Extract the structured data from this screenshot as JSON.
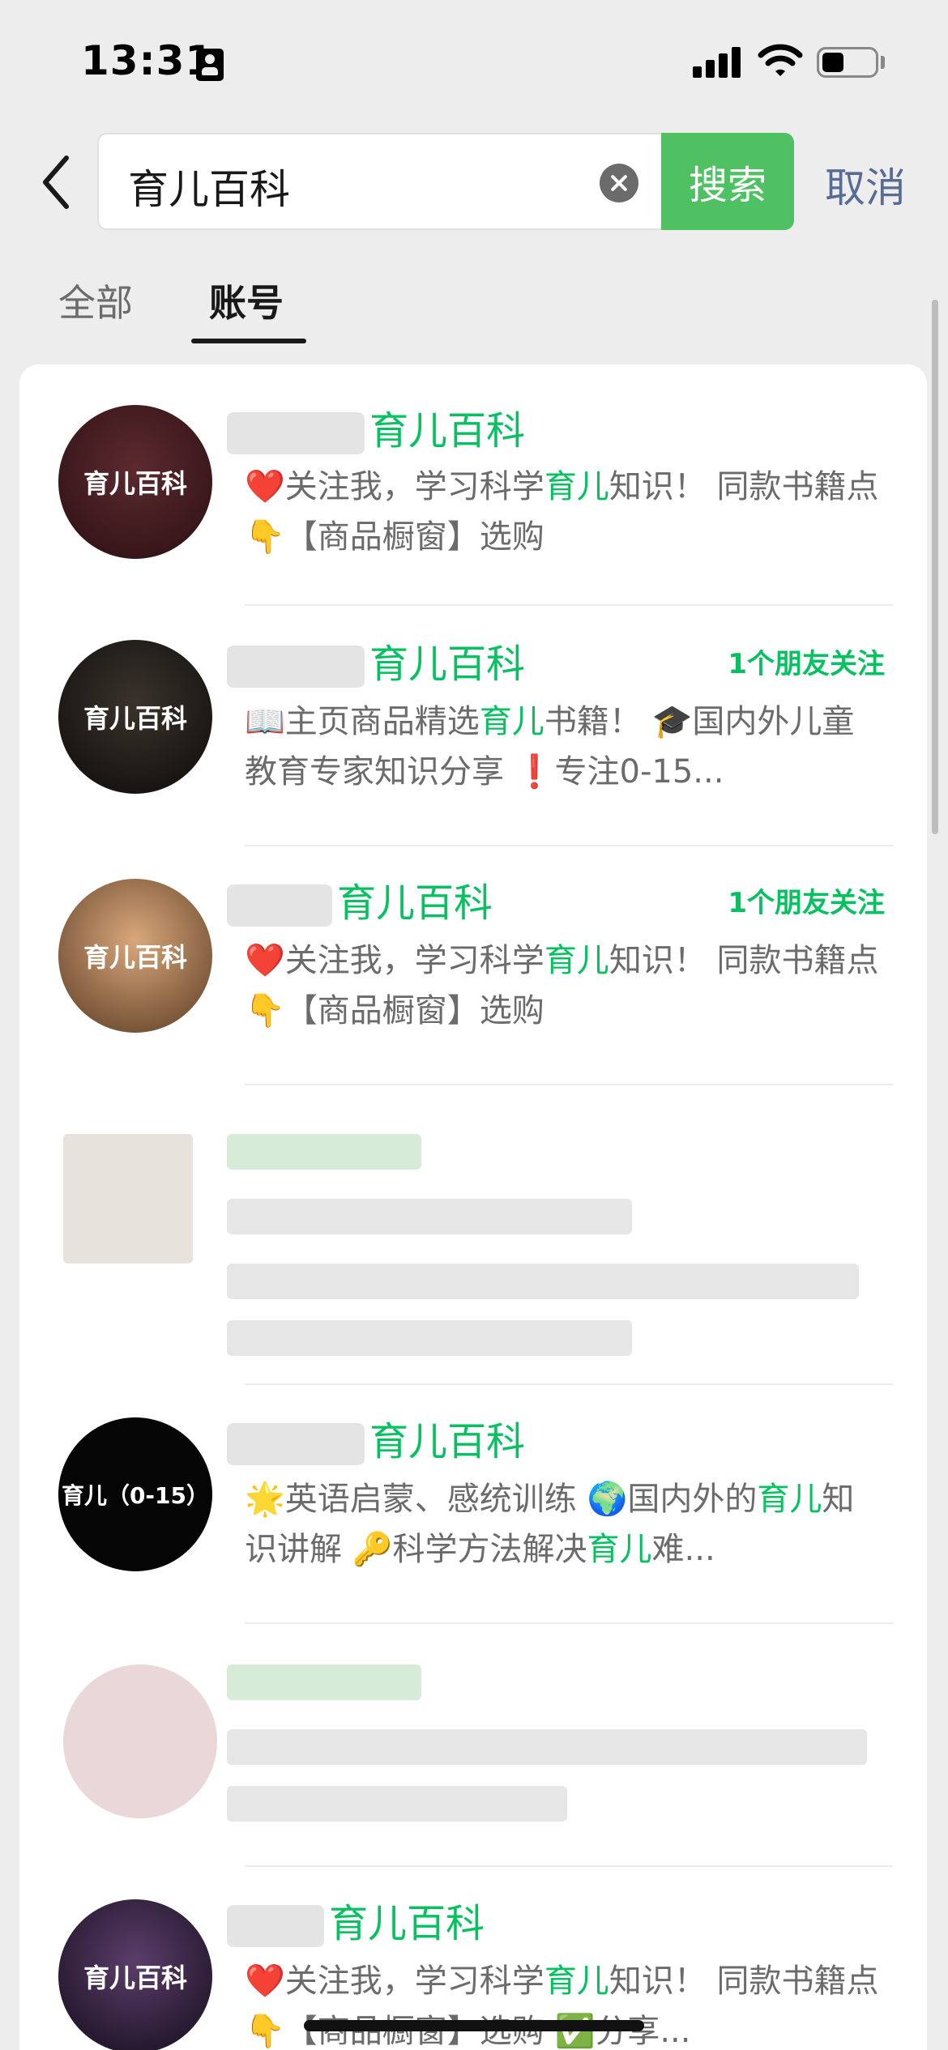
{
  "status_bar": {
    "time": "13:31",
    "battery_level": 0.4
  },
  "search": {
    "query": "育儿百科",
    "search_button": "搜索",
    "cancel_button": "取消"
  },
  "tabs": [
    {
      "label": "全部"
    },
    {
      "label": "账号"
    }
  ],
  "results": [
    {
      "avatar_text": "育儿百科",
      "avatar_color": "#3a1a1e",
      "name": "育儿百科",
      "friends": "",
      "desc_parts": [
        "❤️关注我，学习科学",
        "育儿",
        "知识！ 同款书籍点 👇【商品橱窗】选购"
      ]
    },
    {
      "avatar_text": "育儿百科",
      "avatar_color": "#1e1a18",
      "name": "育儿百科",
      "friends": "1个朋友关注",
      "desc_parts": [
        "📖主页商品精选",
        "育儿",
        "书籍！ 🎓国内外儿童教育专家知识分享 ❗专注0-15..."
      ]
    },
    {
      "avatar_text": "育儿百科",
      "avatar_color": "#b58b63",
      "name": "育儿百科",
      "friends": "1个朋友关注",
      "desc_parts": [
        "❤️关注我，学习科学",
        "育儿",
        "知识！ 同款书籍点 👇【商品橱窗】选购"
      ]
    },
    {
      "avatar_text": "育儿（0-15）",
      "avatar_color": "#050505",
      "name": "育儿百科",
      "friends": "",
      "desc_parts": [
        "🌟英语启蒙、感统训练 🌍国内外的",
        "育儿",
        "知识讲解 🔑科学方法解决",
        "育儿",
        "难..."
      ]
    },
    {
      "avatar_text": "育儿百科",
      "avatar_color": "#2a1f35",
      "name": "育儿百科",
      "friends": "",
      "desc_parts": [
        "❤️关注我，学习科学",
        "育儿",
        "知识！ 同款书籍点 👇【商品橱窗】选购 ✅分享..."
      ]
    }
  ]
}
